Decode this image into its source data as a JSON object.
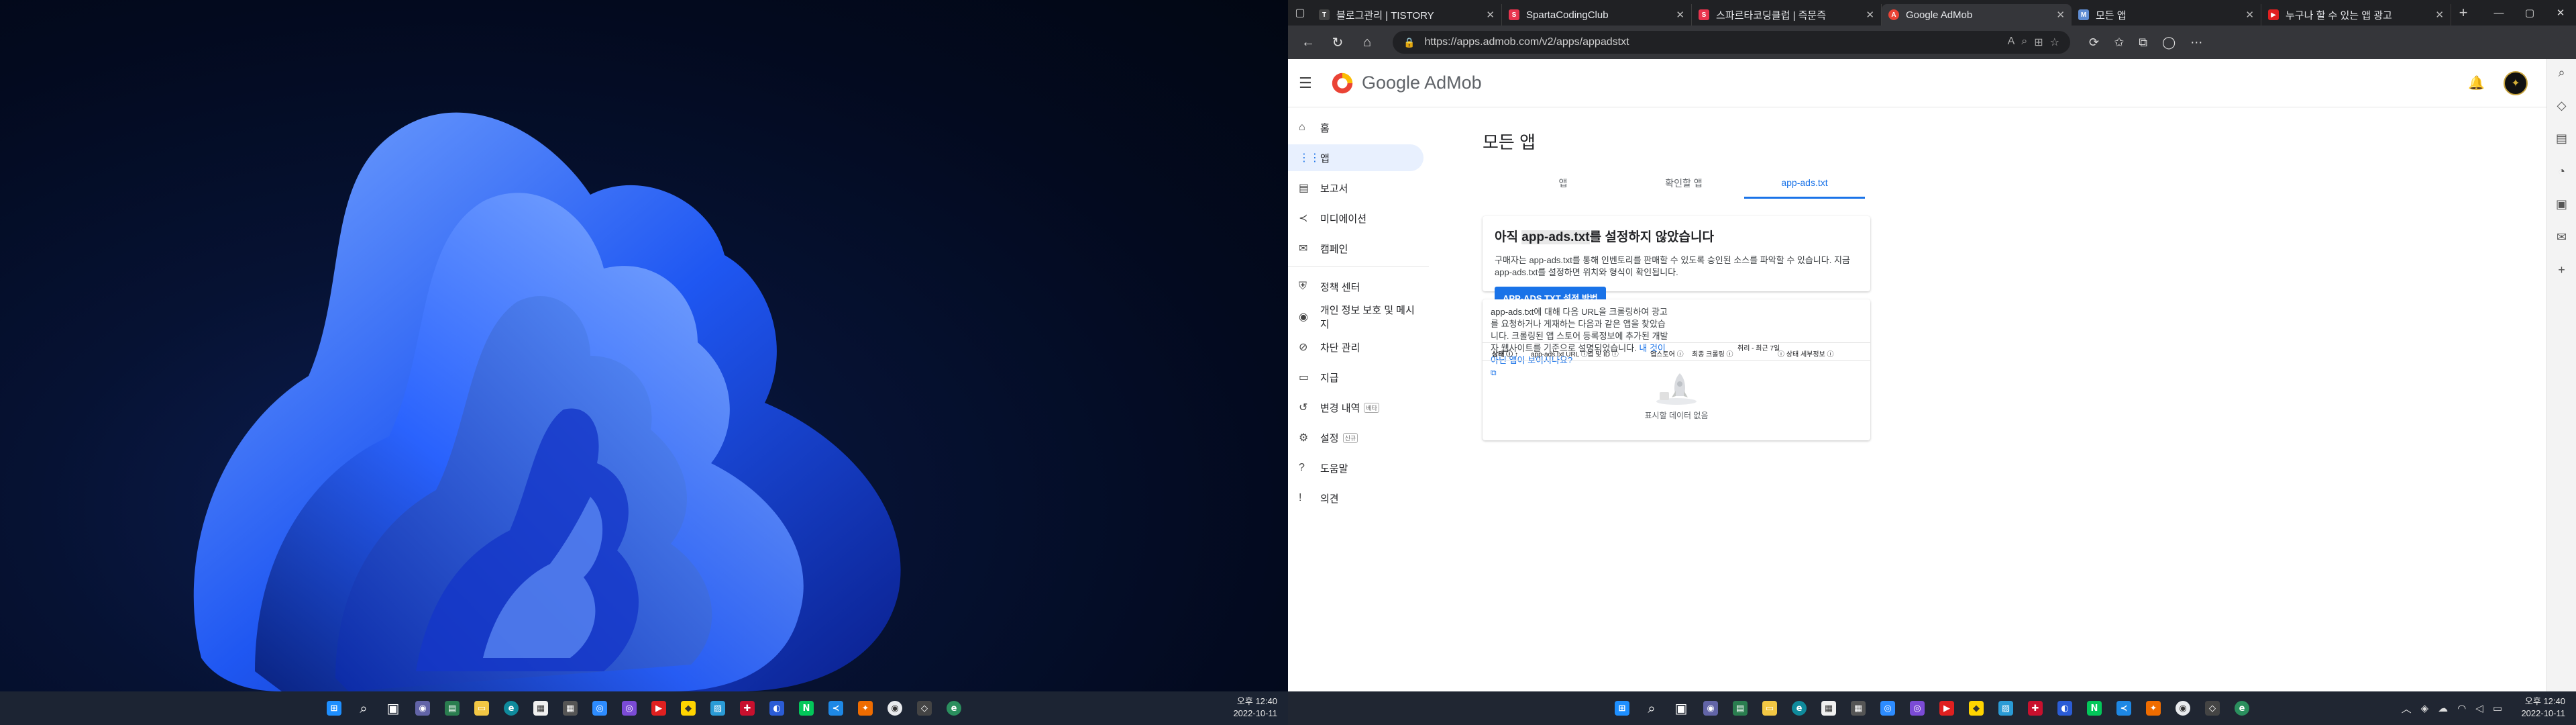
{
  "left_taskbar": {
    "clock_time": "오후 12:40",
    "clock_date": "2022-10-11"
  },
  "right_taskbar": {
    "clock_time": "오후 12:40",
    "clock_date": "2022-10-11"
  },
  "browser": {
    "tabs": [
      {
        "title": "블로그관리 | TISTORY",
        "favicon": "T"
      },
      {
        "title": "SpartaCodingClub",
        "favicon": "S"
      },
      {
        "title": "스파르타코딩클럽 | 즉문즉",
        "favicon": "S"
      },
      {
        "title": "Google AdMob",
        "favicon": "A"
      },
      {
        "title": "모든 앱",
        "favicon": "M"
      },
      {
        "title": "누구나 할 수 있는 앱 광고",
        "favicon": "▶"
      }
    ],
    "url": "https://apps.admob.com/v2/apps/appadstxt"
  },
  "admob": {
    "brand_google": "Google",
    "brand_admob": " AdMob",
    "nav": [
      {
        "label": "홈",
        "icon": "home-icon",
        "glyph": "⌂"
      },
      {
        "label": "앱",
        "icon": "apps-grid-icon",
        "glyph": "⋮⋮"
      },
      {
        "label": "보고서",
        "icon": "reports-icon",
        "glyph": "▤"
      },
      {
        "label": "미디에이션",
        "icon": "mediation-icon",
        "glyph": "≺"
      },
      {
        "label": "캠페인",
        "icon": "campaign-icon",
        "glyph": "✉"
      }
    ],
    "nav2": [
      {
        "label": "정책 센터",
        "icon": "shield-icon",
        "glyph": "⛨"
      },
      {
        "label": "개인 정보 보호 및 메시지",
        "icon": "privacy-icon",
        "glyph": "◉"
      },
      {
        "label": "차단 관리",
        "icon": "block-icon",
        "glyph": "⊘"
      },
      {
        "label": "지급",
        "icon": "payments-icon",
        "glyph": "▭"
      },
      {
        "label": "변경 내역",
        "icon": "history-icon",
        "glyph": "↺",
        "badge": "베타"
      },
      {
        "label": "설정",
        "icon": "settings-icon",
        "glyph": "⚙",
        "badge": "신규"
      },
      {
        "label": "도움말",
        "icon": "help-icon",
        "glyph": "?"
      },
      {
        "label": "의견",
        "icon": "feedback-icon",
        "glyph": "!"
      }
    ],
    "page_title": "모든 앱",
    "tabs": [
      "앱",
      "확인할 앱",
      "app-ads.txt"
    ],
    "card_a": {
      "title_pre": "아직 ",
      "title_hl": "app-ads.txt",
      "title_post": "를 설정하지 않았습니다",
      "desc": "구매자는 app-ads.txt를 통해 인벤토리를 판매할 수 있도록 승인된 소스를 파악할 수 있습니다. 지금 app-ads.txt를 설정하면 위치와 형식이 확인됩니다.",
      "button": "APP-ADS.TXT 설정 방법"
    },
    "card_b": {
      "desc": "app-ads.txt에 대해 다음 URL을 크롤링하여 광고를 요청하거나 게재하는 다음과 같은 앱을 찾았습니다. 크롤링된 앱 스토어 등록정보에 추가된 개발자 웹사이트를 기준으로 설명되었습니다. ",
      "link": "내 것이 아닌 앱이 보이시나요?",
      "headers": [
        "상태 ⓘ ↑",
        "app-ads.txt URL ⓘ",
        "앱 및 ID ⓘ",
        "앱스토어 ⓘ",
        "최종 크롤링 ⓘ",
        "취리 - 최근 7일",
        "ⓘ  상태 세부정보 ⓘ"
      ],
      "empty": "표시할 데이터 없음"
    }
  }
}
